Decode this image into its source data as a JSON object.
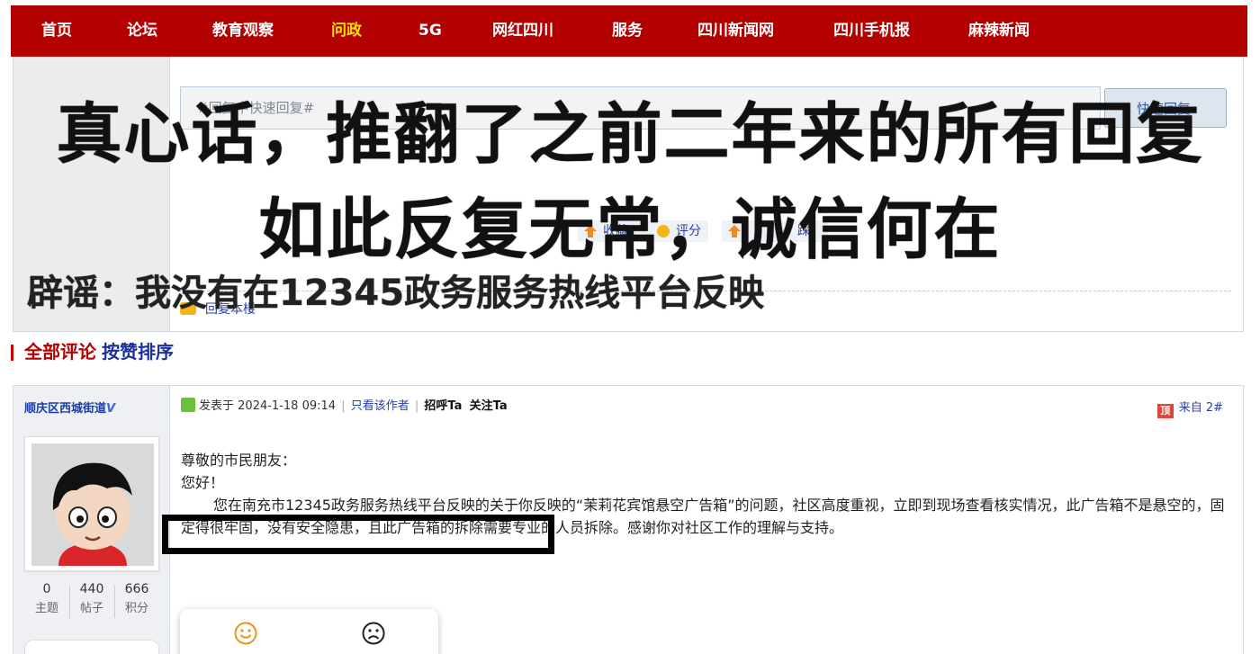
{
  "nav": {
    "items": [
      {
        "label": "首页"
      },
      {
        "label": "论坛"
      },
      {
        "label": "教育观察"
      },
      {
        "label": "问政"
      },
      {
        "label": "5G"
      },
      {
        "label": "网红四川"
      },
      {
        "label": "服务"
      },
      {
        "label": "四川新闻网"
      },
      {
        "label": "四川手机报"
      },
      {
        "label": "麻辣新闻"
      }
    ],
    "active_index": 3
  },
  "top_post": {
    "quick_reply_placeholder": "#回复中快速回复#",
    "quick_reply_button": "快速回复",
    "actions": {
      "favorite": "收藏",
      "rate": "评分",
      "stomp": "踩"
    },
    "reply_floor": "回复本楼"
  },
  "overlay": {
    "headline_line1": "真心话，推翻了之前二年来的所有回复",
    "headline_line2": "如此反复无常，诚信何在",
    "subheadline": "辟谣：我没有在12345政务服务热线平台反映"
  },
  "comments": {
    "tab_all": "全部评论",
    "tab_likes": "按赞排序"
  },
  "comment": {
    "author": "顺庆区西城街道",
    "verified_mark": "V",
    "stats": [
      {
        "value": "0",
        "label": "主题"
      },
      {
        "value": "440",
        "label": "帖子"
      },
      {
        "value": "666",
        "label": "积分"
      }
    ],
    "meta": {
      "posted_prefix": "发表于",
      "datetime": "2024-1-18 09:14",
      "only_author": "只看该作者",
      "greet": "招呼Ta",
      "follow": "关注Ta"
    },
    "from_icon": "顶",
    "from_label": "来自 2#",
    "body": {
      "salutation": "尊敬的市民朋友：",
      "greeting": "您好！",
      "paragraph": "您在南充市12345政务服务热线平台反映的关于你反映的“茉莉花宾馆悬空广告箱”的问题，社区高度重视，立即到现场查看核实情况，此广告箱不是悬空的，固定得很牢固，没有安全隐患，且此广告箱的拆除需要专业的人员拆除。感谢你对社区工作的理解与支持。"
    }
  },
  "colors": {
    "brand_red": "#b30000",
    "active_nav": "#ffe000",
    "link_blue": "#2d3fa0"
  },
  "icons": [
    "favorite-icon",
    "rate-icon",
    "stomp-icon",
    "reply-icon",
    "post-icon",
    "source-icon",
    "smile-face-icon",
    "sad-face-icon"
  ]
}
